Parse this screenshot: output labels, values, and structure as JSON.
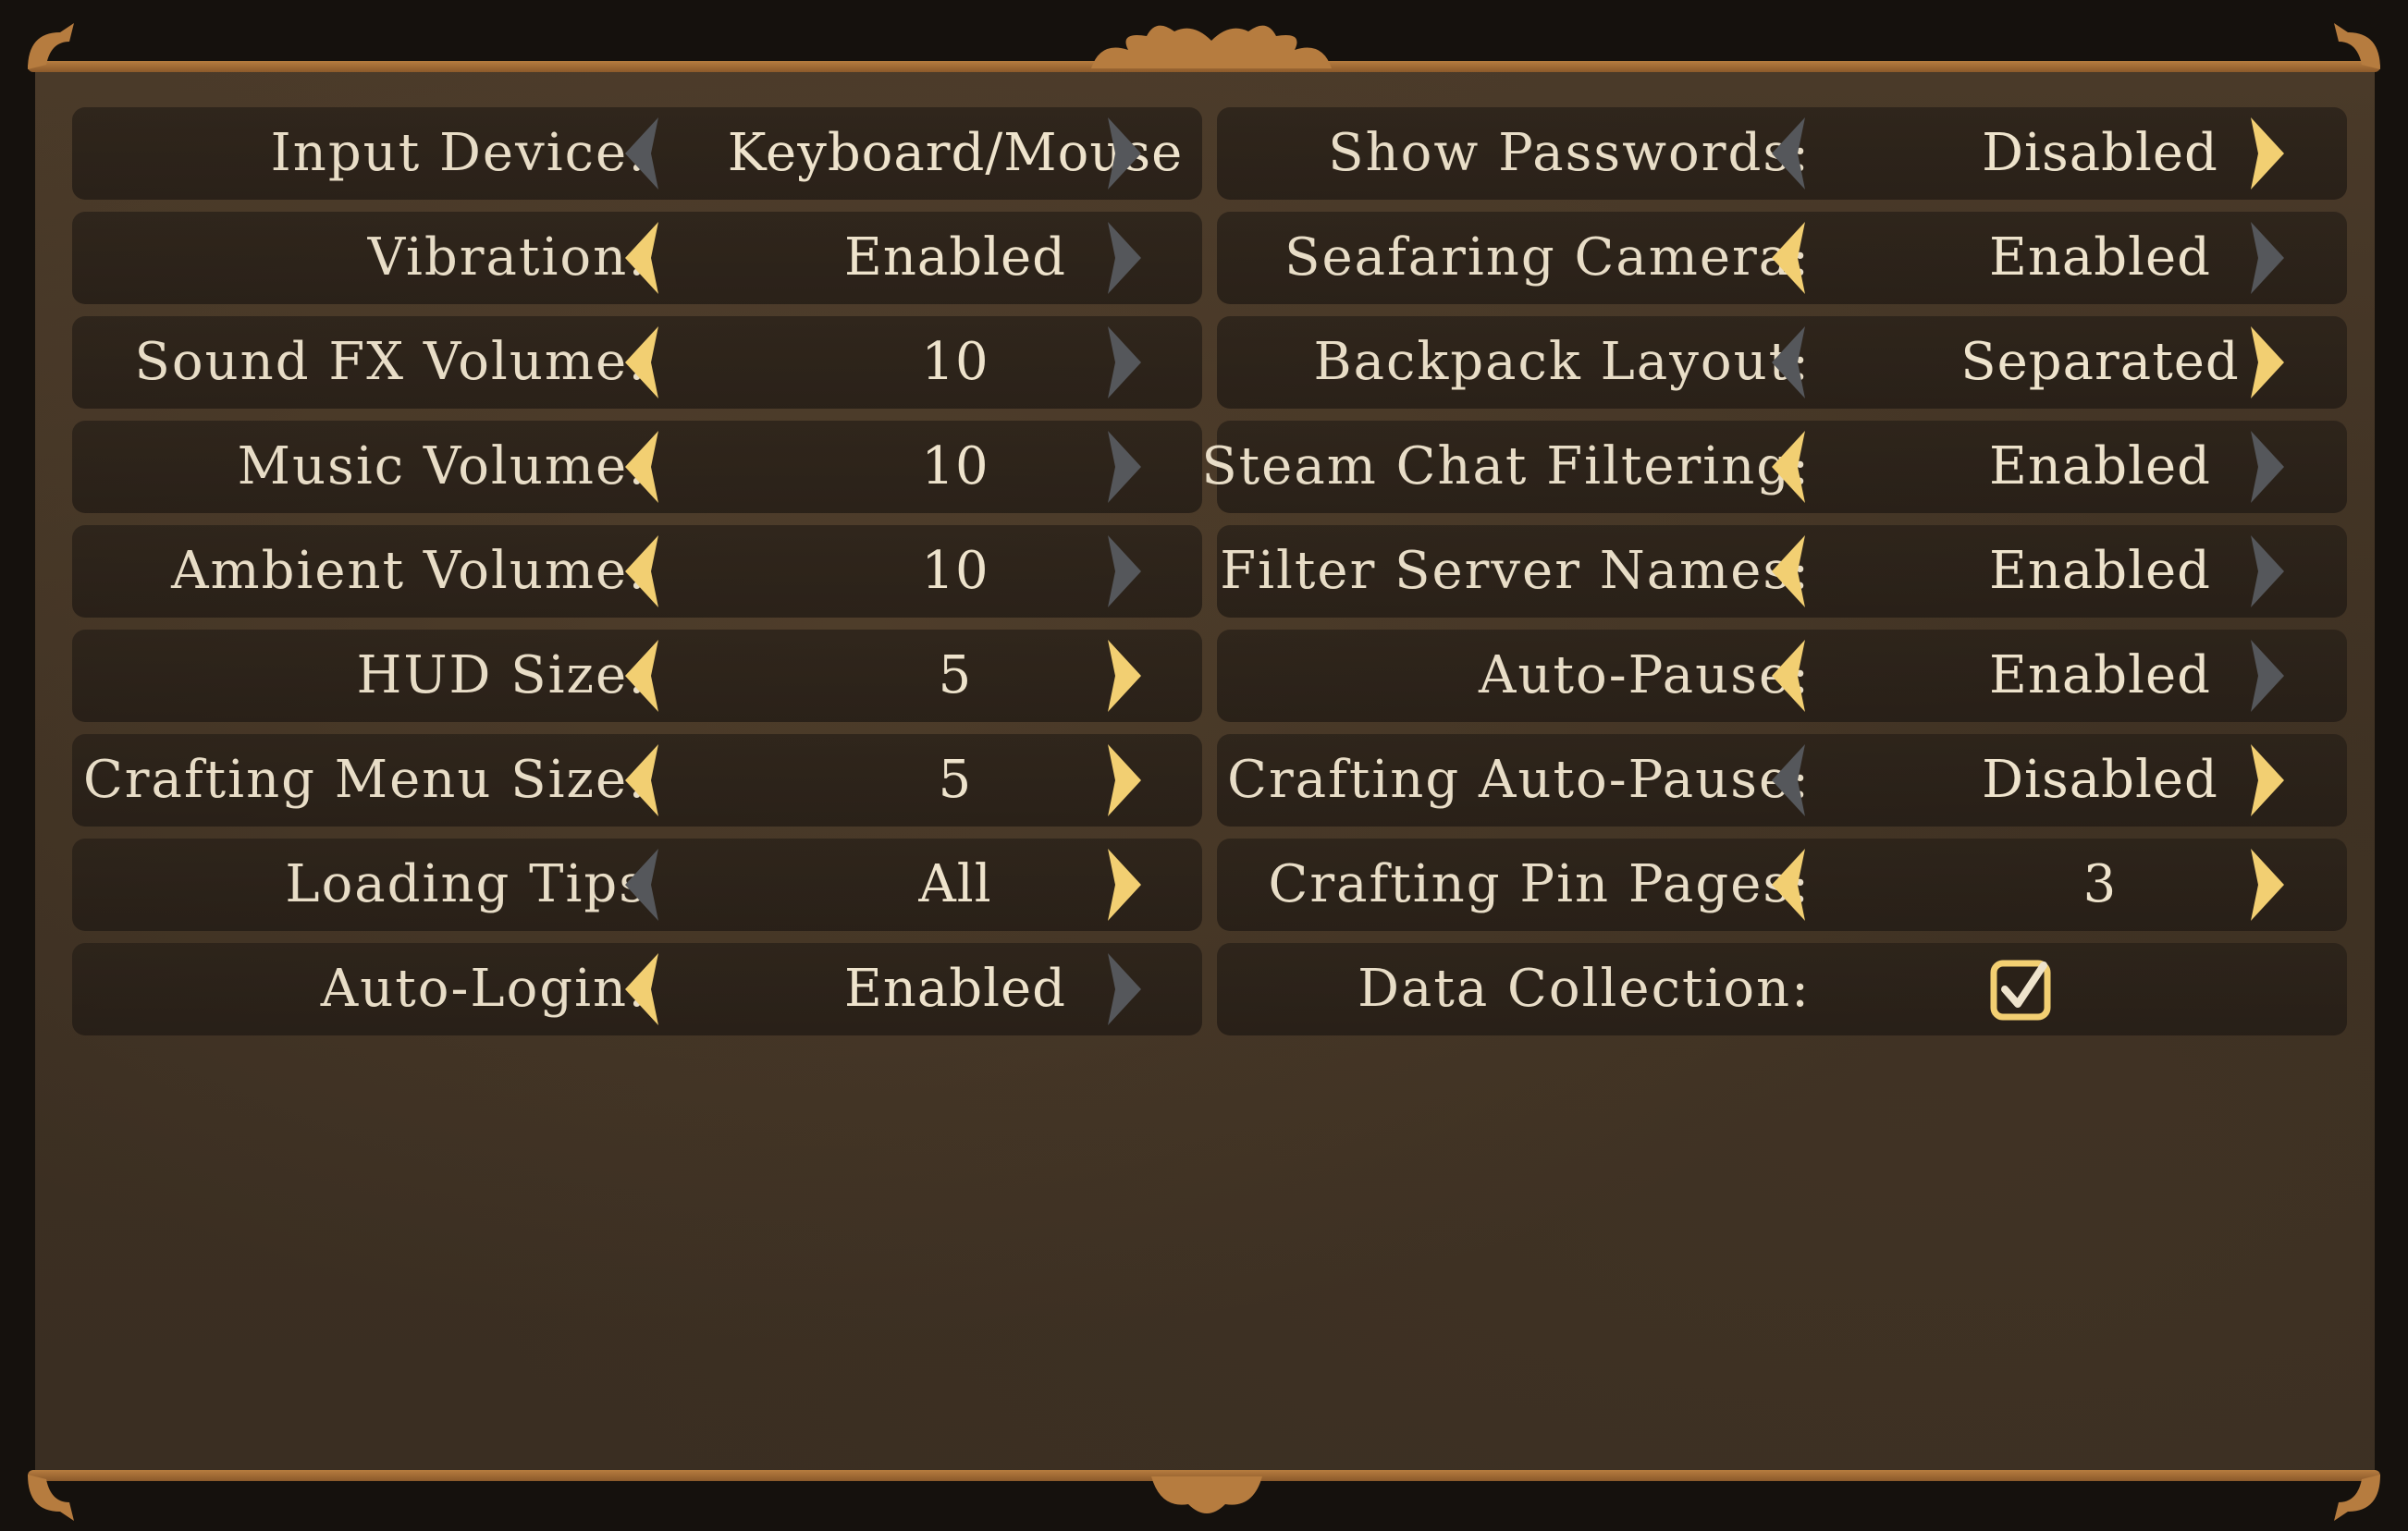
{
  "settings": {
    "left": [
      {
        "label": "Input Device:",
        "value": "Keyboard/Mouse",
        "left_active": false,
        "right_active": false
      },
      {
        "label": "Vibration:",
        "value": "Enabled",
        "left_active": true,
        "right_active": false
      },
      {
        "label": "Sound FX Volume:",
        "value": "10",
        "left_active": true,
        "right_active": false
      },
      {
        "label": "Music Volume:",
        "value": "10",
        "left_active": true,
        "right_active": false
      },
      {
        "label": "Ambient Volume:",
        "value": "10",
        "left_active": true,
        "right_active": false
      },
      {
        "label": "HUD Size:",
        "value": "5",
        "left_active": true,
        "right_active": true
      },
      {
        "label": "Crafting Menu Size:",
        "value": "5",
        "left_active": true,
        "right_active": true
      },
      {
        "label": "Loading Tips",
        "value": "All",
        "left_active": false,
        "right_active": true
      },
      {
        "label": "Auto-Login:",
        "value": "Enabled",
        "left_active": true,
        "right_active": false
      }
    ],
    "right": [
      {
        "label": "Show Passwords:",
        "value": "Disabled",
        "left_active": false,
        "right_active": true
      },
      {
        "label": "Seafaring Camera:",
        "value": "Enabled",
        "left_active": true,
        "right_active": false
      },
      {
        "label": "Backpack Layout:",
        "value": "Separated",
        "left_active": false,
        "right_active": true
      },
      {
        "label": "Steam Chat Filtering:",
        "value": "Enabled",
        "left_active": true,
        "right_active": false
      },
      {
        "label": "Filter Server Names:",
        "value": "Enabled",
        "left_active": true,
        "right_active": false
      },
      {
        "label": "Auto-Pause:",
        "value": "Enabled",
        "left_active": true,
        "right_active": false
      },
      {
        "label": "Crafting Auto-Pause:",
        "value": "Disabled",
        "left_active": false,
        "right_active": true
      },
      {
        "label": "Crafting Pin Pages:",
        "value": "3",
        "left_active": true,
        "right_active": true
      },
      {
        "label": "Data Collection:",
        "checked": true
      }
    ]
  },
  "icons": {
    "arrow_left": "chevron-left-icon",
    "arrow_right": "chevron-right-icon",
    "checkbox": "checkbox-checked-icon"
  },
  "colors": {
    "arrow_active": "#f2cf72",
    "arrow_inactive": "#55575b",
    "border": "#b67c3f",
    "text": "#e8ddc7"
  }
}
